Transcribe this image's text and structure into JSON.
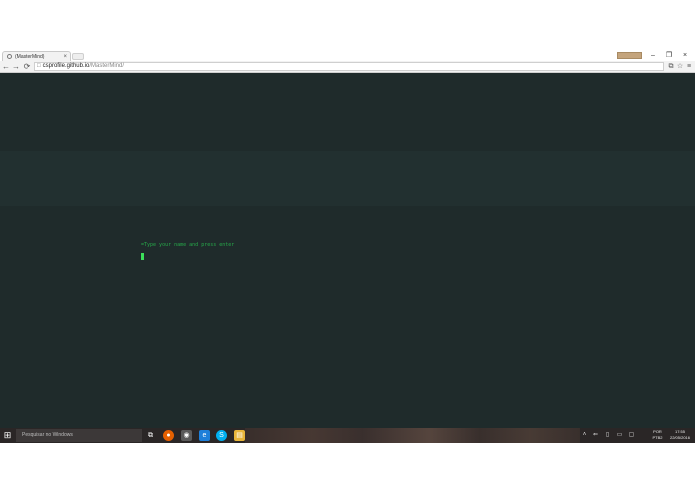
{
  "browser": {
    "tab_title": "(MasterMind)",
    "tab_close": "×",
    "user_badge": "",
    "window_controls": {
      "minimize": "–",
      "restore": "❐",
      "close": "×"
    },
    "nav": {
      "back": "←",
      "forward": "→",
      "reload": "⟳"
    },
    "url_host": "csprofile.github.io",
    "url_path": "/MasterMind/",
    "toolbar_icons": {
      "translate": "⧉",
      "star": "☆",
      "menu": "≡"
    }
  },
  "page": {
    "prompt": "=Type your name and press enter",
    "colors": {
      "background": "#1f2b2b",
      "band": "#223030",
      "text": "#27a84a",
      "cursor": "#3be05a"
    }
  },
  "taskbar": {
    "search_placeholder": "Pesquisar no Windows",
    "apps": [
      {
        "name": "task-view",
        "glyph": "⧉",
        "color": "#2a2626"
      },
      {
        "name": "firefox",
        "glyph": "●",
        "color": "#e66000"
      },
      {
        "name": "chrome",
        "glyph": "◉",
        "color": "#5a5a5a"
      },
      {
        "name": "edge",
        "glyph": "e",
        "color": "#1e7fd9"
      },
      {
        "name": "skype",
        "glyph": "S",
        "color": "#00aff0"
      },
      {
        "name": "file-explorer",
        "glyph": "▤",
        "color": "#e8b53a"
      }
    ],
    "tray_icons": [
      "˄",
      "⇐",
      "▯",
      "▭",
      "▢"
    ],
    "language": "POR",
    "keyboard": "PTB2",
    "time": "17:55",
    "date": "22/05/2016"
  }
}
